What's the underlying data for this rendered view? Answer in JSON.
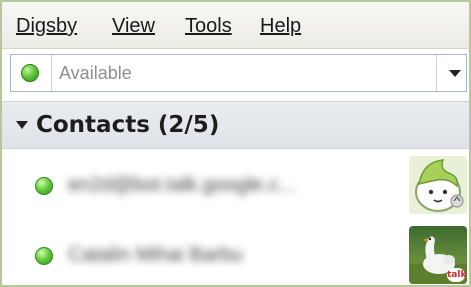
{
  "menubar": {
    "items": [
      {
        "label": "Digsby"
      },
      {
        "label": "View"
      },
      {
        "label": "Tools"
      },
      {
        "label": "Help"
      }
    ]
  },
  "status": {
    "placeholder": "Available",
    "value": "",
    "status_color": "#5fc83a",
    "dropdown_icon": "chevron-down-icon"
  },
  "group": {
    "title": "Contacts (2/5)",
    "expanded": true
  },
  "contacts": [
    {
      "name": "en2d@bot.talk.google.c...",
      "status": "online",
      "blurred": true,
      "avatar_icon": "cartoon-avatar-icon"
    },
    {
      "name": "Catalin Mihai Barbu",
      "status": "online",
      "blurred": true,
      "avatar_icon": "goose-photo-avatar-icon",
      "badge": "talk"
    }
  ],
  "colors": {
    "frame_border": "#b5c998",
    "online_green": "#5fc83a",
    "badge_red": "#cc2a2a"
  }
}
